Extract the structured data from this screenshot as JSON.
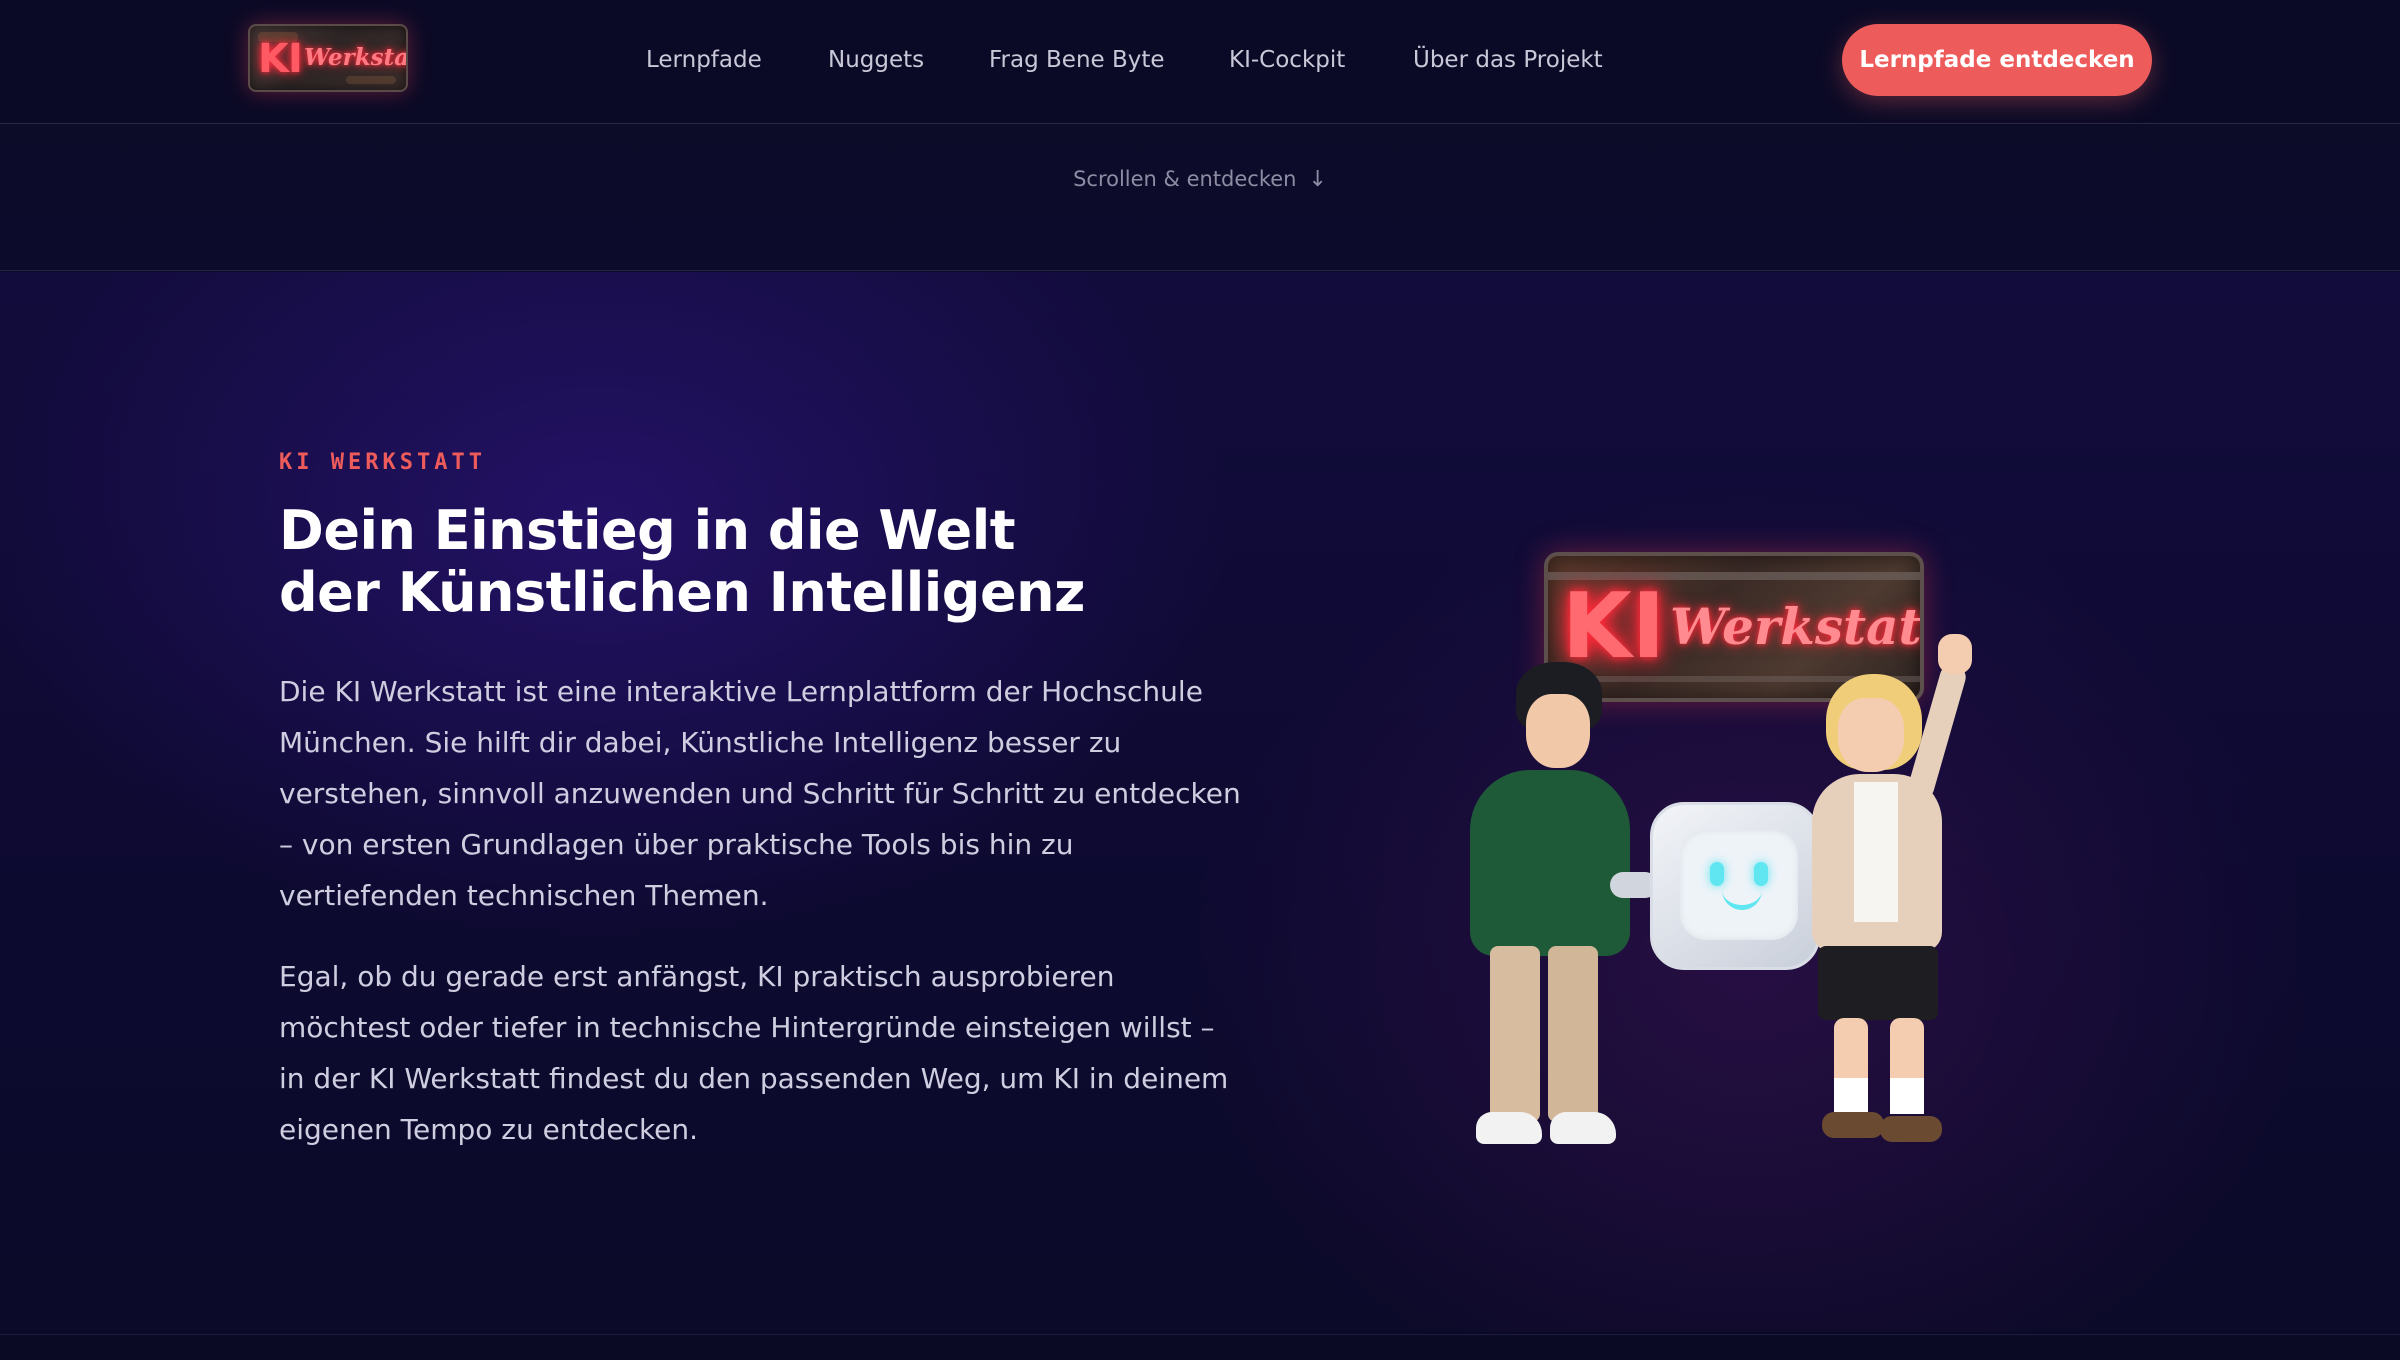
{
  "header": {
    "logo": {
      "ki": "KI",
      "werkstatt": "Werkstatt"
    },
    "nav": [
      {
        "label": "Lernpfade"
      },
      {
        "label": "Nuggets"
      },
      {
        "label": "Frag Bene Byte"
      },
      {
        "label": "KI-Cockpit"
      },
      {
        "label": "Über das Projekt"
      }
    ],
    "cta_label": "Lernpfade entdecken"
  },
  "scroll_hint": {
    "label": "Scrollen & entdecken",
    "icon": "arrow-down-icon"
  },
  "hero": {
    "eyebrow": "KI WERKSTATT",
    "headline_lines": [
      "Dein Einstieg in die Welt",
      "der Künstlichen Intelligenz"
    ],
    "paragraph1_lines": [
      "Die KI Werkstatt ist eine interaktive Lernplattform der Hochschule",
      "München. Sie hilft dir dabei, Künstliche Intelligenz besser zu",
      "verstehen, sinnvoll anzuwenden und Schritt für Schritt zu entdecken",
      "– von ersten Grundlagen über praktische Tools bis hin zu",
      "vertiefenden technischen Themen."
    ],
    "paragraph2_lines": [
      "Egal, ob du gerade erst anfängst, KI praktisch ausprobieren",
      "möchtest oder tiefer in technische Hintergründe einsteigen willst –",
      "in der KI Werkstatt findest du den passenden Weg, um KI in deinem",
      "eigenen Tempo zu entdecken."
    ],
    "illustration": {
      "sign_ki": "KI",
      "sign_werkstatt": "Werkstatt"
    }
  },
  "colors": {
    "accent": "#ee5b5b",
    "background": "#0b0a26",
    "neon": "#ff2a3a"
  }
}
